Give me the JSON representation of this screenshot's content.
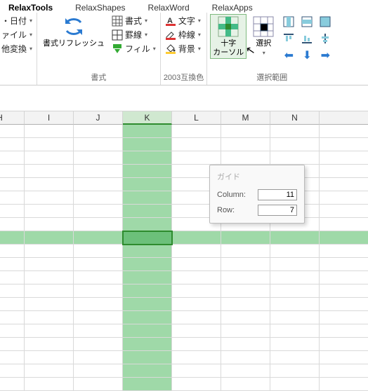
{
  "tabs": {
    "t0": "RelaxTools",
    "t1": "RelaxShapes",
    "t2": "RelaxWord",
    "t3": "RelaxApps"
  },
  "g1": {
    "i0": "・日付",
    "i1": "ァイル",
    "i2": "他変換"
  },
  "g2": {
    "big": "書式リフレッシュ",
    "r0": "書式",
    "r1": "罫線",
    "r2": "フィル",
    "label": "書式"
  },
  "g3": {
    "r0": "文字",
    "r1": "枠線",
    "r2": "背景",
    "label": "2003互換色"
  },
  "g4": {
    "big": "十字\nカーソル",
    "sel": "選択",
    "label": "選択範囲"
  },
  "cols": {
    "c0": "H",
    "c1": "I",
    "c2": "J",
    "c3": "K",
    "c4": "L",
    "c5": "M",
    "c6": "N"
  },
  "guide": {
    "title": "ガイド",
    "colLabel": "Column:",
    "rowLabel": "Row:",
    "colVal": "11",
    "rowVal": "7"
  },
  "chart_data": {
    "type": "table",
    "highlight": {
      "column": "K",
      "column_index": 11,
      "row_index": 7
    }
  }
}
